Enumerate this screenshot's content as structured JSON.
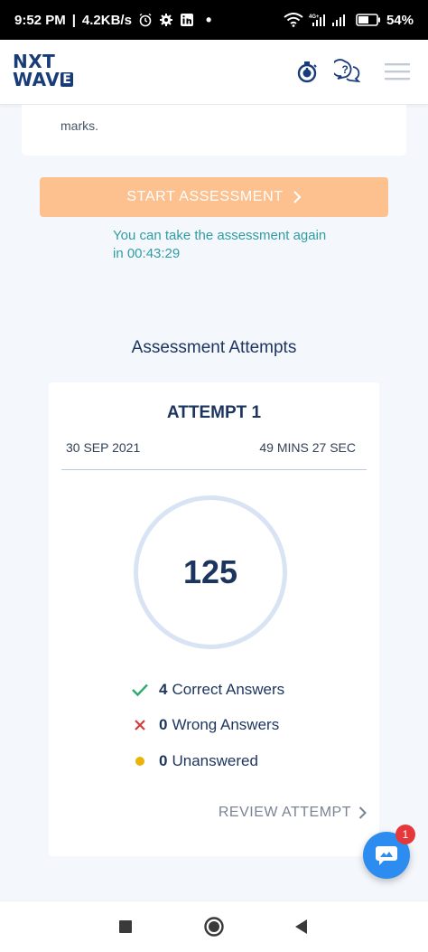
{
  "status_bar": {
    "time": "9:52 PM",
    "speed": "4.2KB/s",
    "battery": "54%",
    "icons": [
      "alarm-icon",
      "gear-icon",
      "linkedin-icon",
      "dot-icon",
      "wifi-icon",
      "signal-icon",
      "battery-icon"
    ]
  },
  "header": {
    "logo_line1": "NXT",
    "logo_line2": "WAV",
    "logo_e": "E",
    "icons": [
      "stopwatch-icon",
      "help-chat-icon",
      "hamburger-menu-icon"
    ]
  },
  "instructions": {
    "trailing_text": "marks."
  },
  "start_button": {
    "label": "START ASSESSMENT"
  },
  "retake_notice": "You can take the assessment again in 00:43:29",
  "attempts": {
    "heading": "Assessment Attempts",
    "items": [
      {
        "title": "ATTEMPT 1",
        "date": "30 SEP 2021",
        "duration": "49 MINS 27 SEC",
        "score": "125",
        "correct_count": "4",
        "correct_label": "Correct Answers",
        "wrong_count": "0",
        "wrong_label": "Wrong Answers",
        "unanswered_count": "0",
        "unanswered_label": "Unanswered",
        "review_label": "REVIEW ATTEMPT"
      }
    ]
  },
  "chat": {
    "badge_count": "1"
  },
  "colors": {
    "brand": "#183b7a",
    "start_button": "#fcc18f",
    "notice": "#2f9ea3",
    "correct": "#2eaa6e",
    "wrong": "#d43b3b",
    "unanswered": "#eab308",
    "chat_fab": "#2d8cf0"
  }
}
